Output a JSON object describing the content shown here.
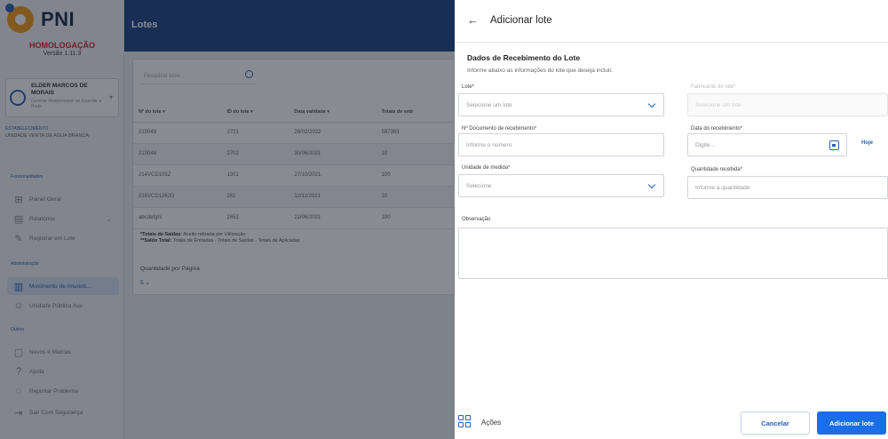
{
  "app": {
    "logo_text": "PNI",
    "environment": "HOMOLOGAÇÃO",
    "version": "Versão 1.11.3"
  },
  "user": {
    "name": "ELDER MARCOS DE MORAIS",
    "role": "Gerente Responsavel de Guardar a Rede"
  },
  "establishment": {
    "label": "ESTABELECIMENTO",
    "value": "UNIDADE VENTA DE AGUA BRANCA"
  },
  "sidebar": {
    "section_functionalities": "Funcionalidades",
    "section_administration": "Administração",
    "section_others": "Outros",
    "items": [
      {
        "label": "Painel Geral"
      },
      {
        "label": "Relatórios"
      },
      {
        "label": "Registrar em Lote"
      },
      {
        "label": "Movimento de Imunob..."
      },
      {
        "label": "Unidade Pública Aux"
      },
      {
        "label": "Novos e Marcas"
      },
      {
        "label": "Ajuda"
      },
      {
        "label": "Reportar Problema"
      },
      {
        "label": "Sair Com Segurança"
      }
    ]
  },
  "header": {
    "title": "Lotes"
  },
  "main": {
    "search_placeholder": "Pesquisar lotes",
    "columns": [
      "Nº do lote",
      "ID do lote",
      "Data validade",
      "Totais de entr"
    ],
    "rows": [
      [
        "210049",
        "2721",
        "28/02/2022",
        "587383"
      ],
      [
        "210048",
        "2702",
        "30/06/2021",
        "10"
      ],
      [
        "214VCD105Z",
        "1301",
        "27/10/2021",
        "100"
      ],
      [
        "216VCD1262D",
        "261",
        "12/11/2021",
        "10"
      ],
      [
        "abcdefghi",
        "2651",
        "22/06/2021",
        "100"
      ]
    ],
    "legend_line1_label": "*Totais de Saídas:",
    "legend_line1_text": "Aceito retirada por Utilização",
    "legend_line2_label": "**Saldo Total:",
    "legend_line2_text": "Totais de Entradas - Totais de Saídas - Totais de Aplicadas",
    "per_page_label": "Quantidade por Página",
    "per_page_value": "5"
  },
  "drawer": {
    "title": "Adicionar lote",
    "section_title": "Dados de Recebimento do Lote",
    "section_subtitle": "Informe abaixo as informações do lote que deseja incluir.",
    "fields": {
      "lote_label": "Lote*",
      "lote_placeholder": "Selecione um lote",
      "fabricante_label": "Fabricante do lote*",
      "fabricante_placeholder": "Selecione um lote",
      "documento_label": "Nº Documento de recebimento*",
      "documento_placeholder": "Informe o número",
      "data_label": "Data do recebimento*",
      "data_placeholder": "Digite...",
      "hoje_label": "Hoje",
      "unidade_label": "Unidade de medida*",
      "unidade_placeholder": "Selecione",
      "quantidade_label": "Quantidade recebida*",
      "quantidade_placeholder": "Informe a quantidade",
      "observacao_label": "Observação"
    },
    "footer": {
      "actions_label": "Ações",
      "cancel_label": "Cancelar",
      "add_label": "Adicionar lote"
    }
  },
  "colors": {
    "brand_blue": "#1e4585",
    "accent": "#1b6ee8",
    "environment_red": "#d8232a"
  }
}
